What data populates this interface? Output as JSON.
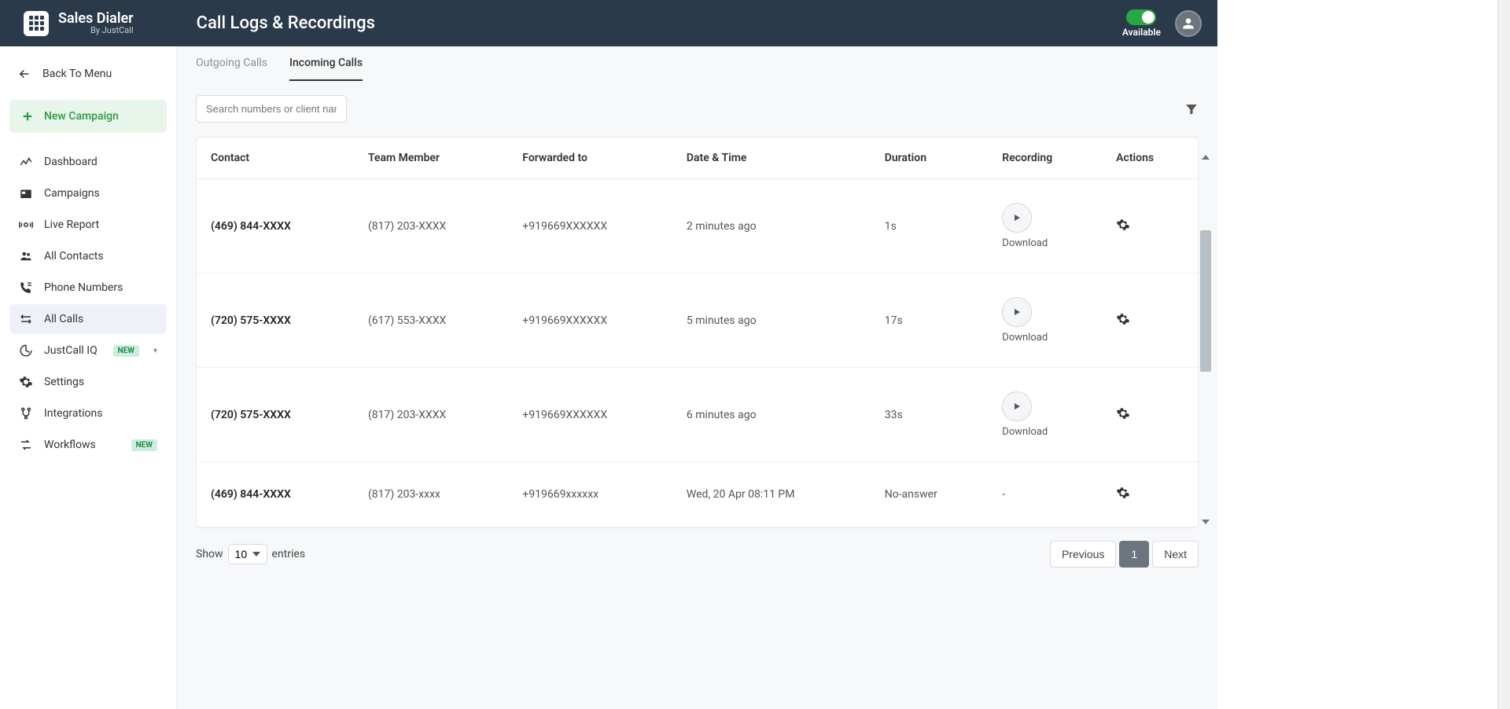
{
  "brand": {
    "title": "Sales Dialer",
    "subtitle": "By JustCall"
  },
  "page_title": "Call Logs & Recordings",
  "availability_label": "Available",
  "back_to_menu": "Back To Menu",
  "new_campaign": "New Campaign",
  "nav": [
    {
      "id": "dashboard",
      "label": "Dashboard"
    },
    {
      "id": "campaigns",
      "label": "Campaigns"
    },
    {
      "id": "live-report",
      "label": "Live Report"
    },
    {
      "id": "all-contacts",
      "label": "All Contacts"
    },
    {
      "id": "phone-numbers",
      "label": "Phone Numbers"
    },
    {
      "id": "all-calls",
      "label": "All Calls"
    },
    {
      "id": "justcall-iq",
      "label": "JustCall IQ",
      "badge": "NEW",
      "chevron": true
    },
    {
      "id": "settings",
      "label": "Settings"
    },
    {
      "id": "integrations",
      "label": "Integrations"
    },
    {
      "id": "workflows",
      "label": "Workflows",
      "badge": "NEW"
    }
  ],
  "tabs": {
    "outgoing": "Outgoing Calls",
    "incoming": "Incoming Calls"
  },
  "search_placeholder": "Search numbers or client name",
  "columns": {
    "contact": "Contact",
    "team_member": "Team Member",
    "forwarded_to": "Forwarded to",
    "date_time": "Date & Time",
    "duration": "Duration",
    "recording": "Recording",
    "actions": "Actions"
  },
  "download_label": "Download",
  "rows": [
    {
      "contact": "(469) 844-XXXX",
      "team_member": "(817) 203-XXXX",
      "forwarded_to": "+919669XXXXXX",
      "date_time": "2 minutes ago",
      "duration": "1s",
      "recording": true
    },
    {
      "contact": "(720) 575-XXXX",
      "team_member": "(617) 553-XXXX",
      "forwarded_to": "+919669XXXXXX",
      "date_time": "5 minutes ago",
      "duration": "17s",
      "recording": true
    },
    {
      "contact": "(720) 575-XXXX",
      "team_member": "(817) 203-XXXX",
      "forwarded_to": "+919669XXXXXX",
      "date_time": "6 minutes ago",
      "duration": "33s",
      "recording": true
    },
    {
      "contact": "(469) 844-XXXX",
      "team_member": "(817) 203-xxxx",
      "forwarded_to": "+919669xxxxxx",
      "date_time": "Wed, 20 Apr 08:11 PM",
      "duration": "No-answer",
      "recording": false
    }
  ],
  "pagination": {
    "show_label": "Show",
    "entries_label": "entries",
    "per_page": "10",
    "previous": "Previous",
    "next": "Next",
    "current": "1"
  }
}
